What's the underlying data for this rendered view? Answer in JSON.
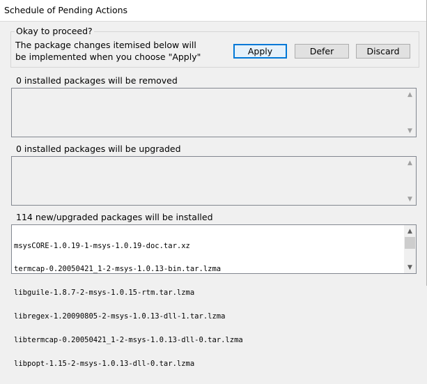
{
  "window": {
    "title": "Schedule of Pending Actions"
  },
  "confirm_group": {
    "label": "Okay to proceed?",
    "message_line1": "The package changes itemised below will",
    "message_line2": "be implemented when you choose \"Apply\"",
    "apply_label": "Apply",
    "defer_label": "Defer",
    "discard_label": "Discard"
  },
  "remove_group": {
    "label": "0 installed packages will be removed",
    "items": []
  },
  "upgrade_group": {
    "label": "0 installed packages will be upgraded",
    "items": []
  },
  "install_group": {
    "label": "114 new/upgraded packages will be installed",
    "items": [
      "msysCORE-1.0.19-1-msys-1.0.19-doc.tar.xz",
      "termcap-0.20050421_1-2-msys-1.0.13-bin.tar.lzma",
      "libguile-1.8.7-2-msys-1.0.15-rtm.tar.lzma",
      "libregex-1.20090805-2-msys-1.0.13-dll-1.tar.lzma",
      "libtermcap-0.20050421_1-2-msys-1.0.13-dll-0.tar.lzma",
      "libpopt-1.15-2-msys-1.0.13-dll-0.tar.lzma"
    ]
  },
  "icons": {
    "scroll_up": "▲",
    "scroll_down": "▼"
  }
}
